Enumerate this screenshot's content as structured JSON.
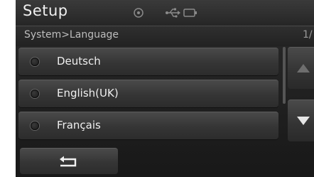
{
  "header": {
    "title": "Setup",
    "status_icons": [
      "disc-icon",
      "usb-icon",
      "battery-icon"
    ]
  },
  "breadcrumb": {
    "path": "System>Language",
    "page": "1/"
  },
  "options": [
    {
      "label": "Deutsch",
      "selected": false
    },
    {
      "label": "English(UK)",
      "selected": false
    },
    {
      "label": "Français",
      "selected": false
    }
  ],
  "controls": {
    "scroll_up_icon": "triangle-up-icon",
    "scroll_down_icon": "triangle-down-icon",
    "back_icon": "return-arrow-icon"
  },
  "colors": {
    "background": "#1e1e1e",
    "button": "#3a3a3a",
    "text": "#efefef"
  }
}
